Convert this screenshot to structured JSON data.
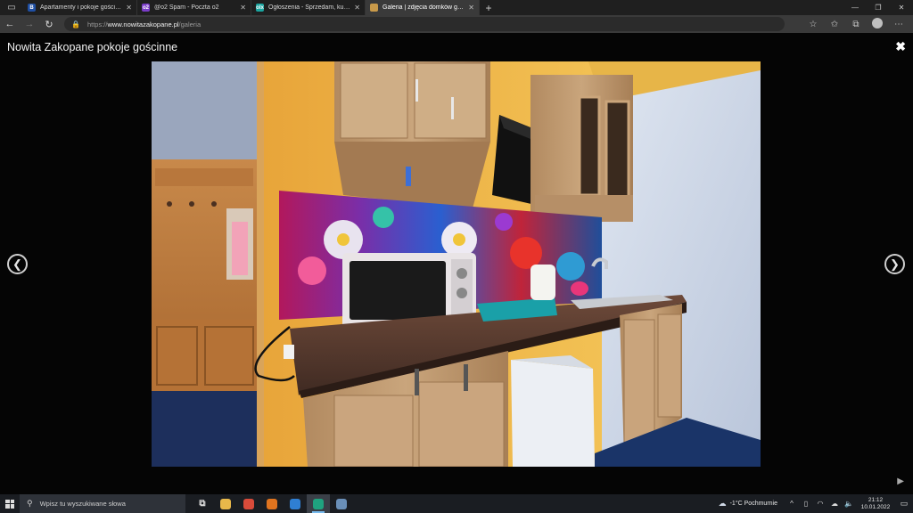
{
  "browser": {
    "tabs": [
      {
        "title": "Apartamenty i pokoje gościnne N",
        "icon": "booking-icon",
        "color": "#1f4fa3",
        "letter": "B",
        "active": false
      },
      {
        "title": "@o2 Spam - Poczta o2",
        "icon": "o2-mail-icon",
        "color": "#7a3cc8",
        "letter": "o2",
        "active": false
      },
      {
        "title": "Ogłoszenia - Sprzedam, kupię n",
        "icon": "olx-icon",
        "color": "#1aa5a0",
        "letter": "olx",
        "active": false
      },
      {
        "title": "Galeria | zdjęcia domków górals",
        "icon": "site-icon",
        "color": "#c99a4a",
        "letter": "",
        "active": true
      }
    ],
    "new_tab": "+",
    "url_scheme": "https://",
    "url_host": "www.nowitazakopane.pl",
    "url_path": "/galeria"
  },
  "lightbox": {
    "title": "Nowita Zakopane pokoje gościnne",
    "close": "✖",
    "prev": "❮",
    "next": "❯",
    "play": "▶"
  },
  "taskbar": {
    "search_placeholder": "Wpisz tu wyszukiwane słowa",
    "weather_temp": "-1°C",
    "weather_text": "Pochmurnie",
    "time": "21:12",
    "date": "10.01.2022",
    "apps": [
      {
        "name": "task-view-icon",
        "glyph": "⧉",
        "color": "transparent"
      },
      {
        "name": "file-explorer-icon",
        "glyph": "",
        "color": "#e8b84a"
      },
      {
        "name": "chrome-icon",
        "glyph": "",
        "color": "#d94b3a"
      },
      {
        "name": "firefox-icon",
        "glyph": "",
        "color": "#e0741f"
      },
      {
        "name": "mail-icon",
        "glyph": "",
        "color": "#2f7fd3"
      },
      {
        "name": "edge-icon",
        "glyph": "",
        "color": "#1fa37f"
      },
      {
        "name": "photos-icon",
        "glyph": "",
        "color": "#6a8fb8"
      }
    ]
  }
}
